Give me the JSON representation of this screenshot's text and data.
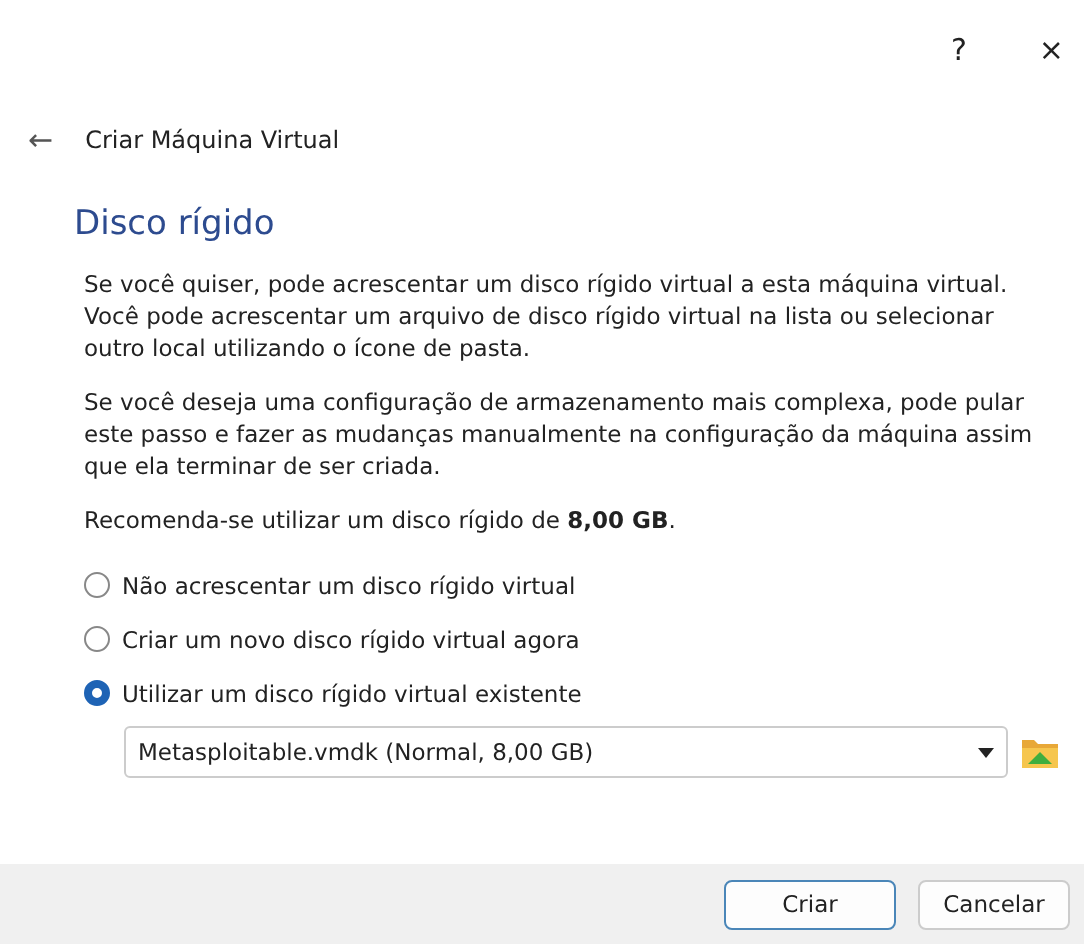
{
  "title_bar": {
    "help": "?",
    "close": "×"
  },
  "header": {
    "back": "←",
    "title": "Criar Máquina Virtual"
  },
  "page": {
    "heading": "Disco rígido",
    "paragraphs": [
      "Se você quiser, pode acrescentar um disco rígido virtual a esta máquina virtual. Você pode acrescentar um arquivo de disco rígido virtual na lista ou selecionar outro local utilizando o ícone de pasta.",
      "Se você deseja uma configuração de armazenamento mais complexa, pode pular este passo e fazer as mudanças manualmente na configuração da máquina assim que ela terminar de ser criada.",
      "Recomenda-se utilizar um disco rígido de **8,00 GB**."
    ],
    "options": [
      {
        "label": "Não acrescentar um disco rígido virtual",
        "selected": false
      },
      {
        "label": "Criar um novo disco rígido virtual agora",
        "selected": false
      },
      {
        "label": "Utilizar um disco rígido virtual existente",
        "selected": true
      }
    ],
    "disk_select": {
      "value": "Metasploitable.vmdk (Normal, 8,00 GB)"
    }
  },
  "buttons": [
    {
      "label": "Criar",
      "default": true
    },
    {
      "label": "Cancelar",
      "default": false
    }
  ]
}
